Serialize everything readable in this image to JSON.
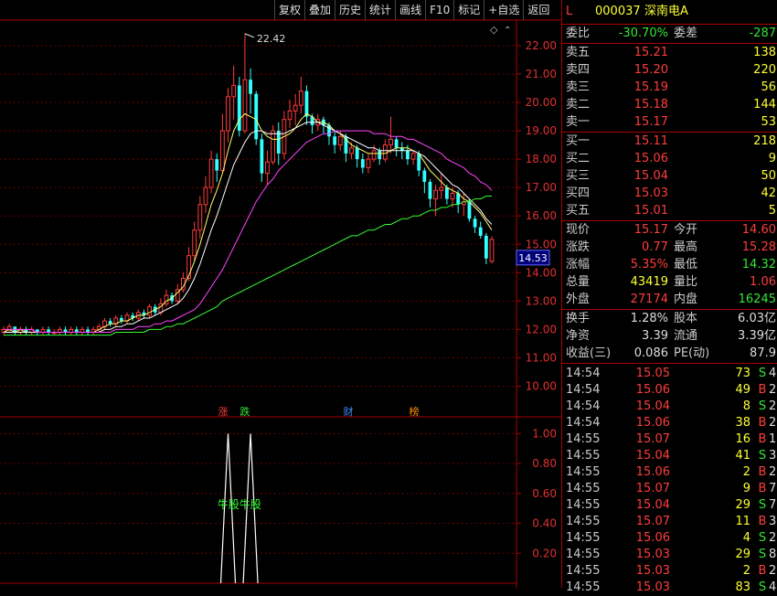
{
  "toolbar": [
    "复权",
    "叠加",
    "历史",
    "统计",
    "画线",
    "F10",
    "标记",
    "+自选",
    "返回"
  ],
  "header": {
    "flag": "L",
    "code": "000037",
    "name": "深南电A"
  },
  "ratio": {
    "wb_label": "委比",
    "wb_value": "-30.70%",
    "wc_label": "委差",
    "wc_value": "-287"
  },
  "asks": [
    {
      "label": "卖五",
      "price": "15.21",
      "vol": "138"
    },
    {
      "label": "卖四",
      "price": "15.20",
      "vol": "220"
    },
    {
      "label": "卖三",
      "price": "15.19",
      "vol": "56"
    },
    {
      "label": "卖二",
      "price": "15.18",
      "vol": "144"
    },
    {
      "label": "卖一",
      "price": "15.17",
      "vol": "53"
    }
  ],
  "bids": [
    {
      "label": "买一",
      "price": "15.11",
      "vol": "218"
    },
    {
      "label": "买二",
      "price": "15.06",
      "vol": "9"
    },
    {
      "label": "买三",
      "price": "15.04",
      "vol": "50"
    },
    {
      "label": "买四",
      "price": "15.03",
      "vol": "42"
    },
    {
      "label": "买五",
      "price": "15.01",
      "vol": "5"
    }
  ],
  "stats": [
    {
      "l1": "现价",
      "v1": "15.17",
      "c1": "red",
      "l2": "今开",
      "v2": "14.60",
      "c2": "red"
    },
    {
      "l1": "涨跌",
      "v1": "0.77",
      "c1": "red",
      "l2": "最高",
      "v2": "15.28",
      "c2": "red"
    },
    {
      "l1": "涨幅",
      "v1": "5.35%",
      "c1": "red",
      "l2": "最低",
      "v2": "14.32",
      "c2": "grn"
    },
    {
      "l1": "总量",
      "v1": "43419",
      "c1": "yel",
      "l2": "量比",
      "v2": "1.06",
      "c2": "red"
    },
    {
      "l1": "外盘",
      "v1": "27174",
      "c1": "red",
      "l2": "内盘",
      "v2": "16245",
      "c2": "grn"
    }
  ],
  "stats2": [
    {
      "l1": "换手",
      "v1": "1.28%",
      "l2": "股本",
      "v2": "6.03亿"
    },
    {
      "l1": "净资",
      "v1": "3.39",
      "l2": "流通",
      "v2": "3.39亿"
    },
    {
      "l1": "收益(三)",
      "v1": "0.086",
      "l2": "PE(动)",
      "v2": "87.9"
    }
  ],
  "ticks": [
    {
      "t": "14:54",
      "p": "15.05",
      "pc": "red",
      "v": "73",
      "f": "S",
      "fc": "grn",
      "n": "4"
    },
    {
      "t": "14:54",
      "p": "15.06",
      "pc": "red",
      "v": "49",
      "f": "B",
      "fc": "red",
      "n": "2"
    },
    {
      "t": "14:54",
      "p": "15.04",
      "pc": "red",
      "v": "8",
      "f": "S",
      "fc": "grn",
      "n": "2"
    },
    {
      "t": "14:54",
      "p": "15.06",
      "pc": "red",
      "v": "38",
      "f": "B",
      "fc": "red",
      "n": "2"
    },
    {
      "t": "14:55",
      "p": "15.07",
      "pc": "red",
      "v": "16",
      "f": "B",
      "fc": "red",
      "n": "1"
    },
    {
      "t": "14:55",
      "p": "15.04",
      "pc": "red",
      "v": "41",
      "f": "S",
      "fc": "grn",
      "n": "3"
    },
    {
      "t": "14:55",
      "p": "15.06",
      "pc": "red",
      "v": "2",
      "f": "B",
      "fc": "red",
      "n": "2"
    },
    {
      "t": "14:55",
      "p": "15.07",
      "pc": "red",
      "v": "9",
      "f": "B",
      "fc": "red",
      "n": "7"
    },
    {
      "t": "14:55",
      "p": "15.04",
      "pc": "red",
      "v": "29",
      "f": "S",
      "fc": "grn",
      "n": "7"
    },
    {
      "t": "14:55",
      "p": "15.07",
      "pc": "red",
      "v": "11",
      "f": "B",
      "fc": "red",
      "n": "3"
    },
    {
      "t": "14:55",
      "p": "15.06",
      "pc": "red",
      "v": "4",
      "f": "S",
      "fc": "grn",
      "n": "2"
    },
    {
      "t": "14:55",
      "p": "15.03",
      "pc": "red",
      "v": "29",
      "f": "S",
      "fc": "grn",
      "n": "8"
    },
    {
      "t": "14:55",
      "p": "15.03",
      "pc": "red",
      "v": "2",
      "f": "B",
      "fc": "red",
      "n": "2"
    },
    {
      "t": "14:55",
      "p": "15.03",
      "pc": "red",
      "v": "83",
      "f": "S",
      "fc": "grn",
      "n": "4"
    }
  ],
  "chart_data": {
    "type": "candlestick",
    "y_ticks": [
      "22.00",
      "21.00",
      "20.00",
      "19.00",
      "18.00",
      "17.00",
      "16.00",
      "15.00",
      "14.00",
      "13.00",
      "12.00",
      "11.00",
      "10.00"
    ],
    "ylim": [
      9.5,
      22.9
    ],
    "high_annotation": "22.42",
    "current_price_label": "14.53",
    "event_markers": [
      {
        "text": "涨",
        "color": "#ff3c3c"
      },
      {
        "text": "跌",
        "color": "#32e632"
      },
      {
        "text": "财",
        "color": "#3c8cff"
      },
      {
        "text": "榜",
        "color": "#ff8c00"
      }
    ],
    "candles": [
      [
        11.9,
        12.0,
        11.8,
        12.1
      ],
      [
        12.0,
        12.1,
        11.9,
        12.2
      ],
      [
        12.1,
        11.9,
        11.8,
        12.1
      ],
      [
        11.9,
        12.0,
        11.8,
        12.1
      ],
      [
        12.0,
        11.9,
        11.8,
        12.1
      ],
      [
        11.9,
        12.0,
        11.8,
        12.1
      ],
      [
        12.0,
        11.9,
        11.8,
        12.0
      ],
      [
        11.9,
        12.0,
        11.8,
        12.1
      ],
      [
        12.0,
        11.9,
        11.8,
        12.1
      ],
      [
        11.9,
        11.9,
        11.8,
        12.0
      ],
      [
        11.9,
        12.0,
        11.8,
        12.1
      ],
      [
        12.0,
        11.9,
        11.8,
        12.1
      ],
      [
        11.9,
        12.0,
        11.8,
        12.1
      ],
      [
        12.0,
        11.9,
        11.8,
        12.1
      ],
      [
        11.9,
        12.0,
        11.8,
        12.1
      ],
      [
        12.0,
        11.9,
        11.8,
        12.1
      ],
      [
        11.9,
        12.0,
        11.8,
        12.1
      ],
      [
        12.0,
        12.1,
        11.9,
        12.2
      ],
      [
        12.1,
        12.3,
        12.0,
        12.4
      ],
      [
        12.3,
        12.2,
        12.1,
        12.4
      ],
      [
        12.2,
        12.4,
        12.1,
        12.5
      ],
      [
        12.4,
        12.3,
        12.2,
        12.5
      ],
      [
        12.3,
        12.5,
        12.2,
        12.6
      ],
      [
        12.5,
        12.4,
        12.3,
        12.6
      ],
      [
        12.4,
        12.6,
        12.3,
        12.7
      ],
      [
        12.6,
        12.5,
        12.4,
        12.7
      ],
      [
        12.5,
        12.8,
        12.4,
        12.9
      ],
      [
        12.8,
        12.6,
        12.5,
        12.9
      ],
      [
        12.6,
        12.9,
        12.5,
        13.1
      ],
      [
        12.9,
        13.2,
        12.8,
        13.4
      ],
      [
        13.2,
        13.0,
        12.9,
        13.3
      ],
      [
        13.0,
        13.4,
        12.9,
        13.6
      ],
      [
        13.4,
        13.8,
        13.3,
        14.0
      ],
      [
        13.8,
        14.6,
        13.7,
        14.9
      ],
      [
        14.6,
        15.5,
        14.4,
        15.8
      ],
      [
        15.5,
        16.4,
        15.2,
        16.7
      ],
      [
        16.4,
        17.0,
        16.1,
        17.4
      ],
      [
        17.0,
        18.0,
        16.8,
        18.3
      ],
      [
        18.0,
        17.6,
        17.2,
        18.2
      ],
      [
        17.6,
        19.0,
        17.5,
        19.6
      ],
      [
        19.0,
        20.2,
        18.6,
        20.5
      ],
      [
        20.2,
        20.6,
        19.4,
        21.3
      ],
      [
        20.6,
        19.0,
        18.8,
        20.9
      ],
      [
        19.0,
        20.8,
        18.9,
        22.42
      ],
      [
        20.8,
        20.3,
        19.6,
        21.2
      ],
      [
        20.3,
        18.7,
        18.5,
        20.4
      ],
      [
        18.7,
        17.5,
        17.2,
        18.9
      ],
      [
        17.5,
        17.9,
        17.1,
        18.3
      ],
      [
        17.9,
        19.0,
        17.8,
        19.2
      ],
      [
        19.0,
        18.2,
        17.8,
        19.3
      ],
      [
        18.2,
        19.4,
        18.0,
        19.7
      ],
      [
        19.4,
        19.7,
        19.1,
        20.1
      ],
      [
        19.7,
        19.9,
        19.2,
        20.3
      ],
      [
        19.9,
        20.4,
        19.6,
        20.9
      ],
      [
        20.4,
        19.5,
        19.2,
        20.6
      ],
      [
        19.5,
        19.2,
        18.9,
        19.6
      ],
      [
        19.2,
        19.4,
        19.0,
        19.6
      ],
      [
        19.4,
        19.2,
        18.9,
        19.5
      ],
      [
        19.2,
        18.8,
        18.5,
        19.3
      ],
      [
        18.8,
        18.5,
        18.2,
        19.0
      ],
      [
        18.5,
        18.8,
        18.3,
        19.0
      ],
      [
        18.8,
        18.2,
        17.9,
        18.9
      ],
      [
        18.2,
        18.4,
        18.0,
        18.6
      ],
      [
        18.4,
        18.0,
        17.7,
        18.5
      ],
      [
        18.0,
        17.7,
        17.5,
        18.2
      ],
      [
        17.7,
        18.0,
        17.5,
        18.2
      ],
      [
        18.0,
        18.3,
        17.9,
        18.5
      ],
      [
        18.3,
        18.0,
        17.8,
        18.4
      ],
      [
        18.0,
        18.5,
        17.9,
        18.7
      ],
      [
        18.5,
        18.7,
        18.2,
        19.5
      ],
      [
        18.7,
        18.4,
        18.1,
        18.8
      ],
      [
        18.4,
        18.3,
        18.0,
        18.6
      ],
      [
        18.3,
        18.0,
        17.8,
        18.5
      ],
      [
        18.0,
        18.2,
        17.8,
        18.3
      ],
      [
        18.2,
        17.6,
        17.4,
        18.3
      ],
      [
        17.6,
        17.2,
        16.8,
        17.7
      ],
      [
        17.2,
        16.6,
        16.3,
        17.3
      ],
      [
        16.6,
        16.9,
        16.0,
        17.1
      ],
      [
        16.9,
        17.0,
        16.6,
        17.5
      ],
      [
        17.0,
        16.6,
        16.4,
        17.1
      ],
      [
        16.6,
        16.8,
        16.3,
        17.0
      ],
      [
        16.8,
        16.4,
        16.1,
        16.9
      ],
      [
        16.4,
        16.5,
        16.0,
        16.8
      ],
      [
        16.5,
        15.9,
        15.8,
        16.6
      ],
      [
        15.9,
        15.6,
        15.4,
        16.0
      ],
      [
        15.6,
        15.3,
        15.2,
        15.8
      ],
      [
        15.3,
        14.5,
        14.3,
        15.4
      ],
      [
        14.4,
        15.17,
        14.32,
        15.28
      ]
    ],
    "lines": [
      {
        "color": "#ffff66",
        "values": [
          11.9,
          12.0,
          11.9,
          12.0,
          11.9,
          11.9,
          11.9,
          11.9,
          11.9,
          11.9,
          11.9,
          11.9,
          11.9,
          11.9,
          11.9,
          11.9,
          11.9,
          12.0,
          12.1,
          12.2,
          12.2,
          12.3,
          12.3,
          12.4,
          12.5,
          12.5,
          12.6,
          12.7,
          12.8,
          13.0,
          13.1,
          13.3,
          13.5,
          13.9,
          14.4,
          15.0,
          15.7,
          16.4,
          16.9,
          17.5,
          18.3,
          19.0,
          19.4,
          19.6,
          19.5,
          19.4,
          19.0,
          18.8,
          18.7,
          18.7,
          18.8,
          18.9,
          19.1,
          19.4,
          19.6,
          19.5,
          19.3,
          19.3,
          19.2,
          19.0,
          18.9,
          18.7,
          18.5,
          18.4,
          18.3,
          18.2,
          18.2,
          18.2,
          18.2,
          18.3,
          18.4,
          18.4,
          18.4,
          18.3,
          18.2,
          17.9,
          17.6,
          17.4,
          17.2,
          17.0,
          16.9,
          16.8,
          16.6,
          16.5,
          16.3,
          16.1,
          15.8,
          15.5
        ]
      },
      {
        "color": "#ffffff",
        "values": [
          11.9,
          11.9,
          11.9,
          11.9,
          11.9,
          11.9,
          11.9,
          11.9,
          11.9,
          11.9,
          11.9,
          11.9,
          11.9,
          11.9,
          11.9,
          11.9,
          11.9,
          11.9,
          12.0,
          12.0,
          12.1,
          12.1,
          12.2,
          12.2,
          12.3,
          12.4,
          12.4,
          12.5,
          12.6,
          12.7,
          12.8,
          12.9,
          13.1,
          13.4,
          13.8,
          14.3,
          14.9,
          15.5,
          16.0,
          16.6,
          17.2,
          17.8,
          18.2,
          18.6,
          18.9,
          19.0,
          19.0,
          18.9,
          18.9,
          18.9,
          18.9,
          19.0,
          19.1,
          19.2,
          19.3,
          19.3,
          19.3,
          19.2,
          19.1,
          19.0,
          18.9,
          18.8,
          18.7,
          18.6,
          18.5,
          18.4,
          18.4,
          18.3,
          18.3,
          18.3,
          18.3,
          18.3,
          18.3,
          18.3,
          18.2,
          18.1,
          17.9,
          17.7,
          17.5,
          17.3,
          17.1,
          17.0,
          16.8,
          16.6,
          16.4,
          16.2,
          15.9,
          15.7
        ]
      },
      {
        "color": "#ff44ff",
        "values": [
          12.0,
          12.0,
          12.0,
          12.0,
          12.0,
          12.0,
          11.9,
          11.9,
          11.9,
          11.9,
          11.9,
          11.9,
          11.9,
          11.9,
          11.9,
          11.9,
          11.9,
          11.9,
          11.9,
          11.9,
          12.0,
          12.0,
          12.0,
          12.0,
          12.1,
          12.1,
          12.1,
          12.2,
          12.2,
          12.3,
          12.3,
          12.4,
          12.5,
          12.6,
          12.7,
          12.9,
          13.2,
          13.5,
          13.8,
          14.1,
          14.5,
          14.9,
          15.3,
          15.7,
          16.1,
          16.5,
          16.8,
          17.1,
          17.3,
          17.6,
          17.8,
          18.0,
          18.2,
          18.4,
          18.6,
          18.7,
          18.8,
          18.9,
          18.9,
          19.0,
          19.0,
          19.0,
          19.0,
          19.0,
          19.0,
          19.0,
          18.9,
          18.9,
          18.9,
          18.8,
          18.8,
          18.8,
          18.7,
          18.7,
          18.6,
          18.5,
          18.4,
          18.3,
          18.2,
          18.0,
          17.9,
          17.8,
          17.7,
          17.5,
          17.4,
          17.2,
          17.1,
          16.9
        ]
      },
      {
        "color": "#33ff33",
        "values": [
          11.8,
          11.8,
          11.8,
          11.8,
          11.8,
          11.8,
          11.8,
          11.8,
          11.8,
          11.8,
          11.8,
          11.8,
          11.8,
          11.8,
          11.8,
          11.8,
          11.8,
          11.8,
          11.8,
          11.8,
          11.9,
          11.9,
          11.9,
          11.9,
          11.9,
          11.9,
          12.0,
          12.0,
          12.0,
          12.1,
          12.1,
          12.2,
          12.2,
          12.3,
          12.4,
          12.5,
          12.6,
          12.7,
          12.8,
          13.0,
          13.1,
          13.2,
          13.3,
          13.4,
          13.5,
          13.6,
          13.7,
          13.8,
          13.9,
          14.0,
          14.1,
          14.2,
          14.3,
          14.4,
          14.5,
          14.6,
          14.7,
          14.8,
          14.9,
          15.0,
          15.1,
          15.2,
          15.3,
          15.3,
          15.4,
          15.5,
          15.5,
          15.6,
          15.7,
          15.7,
          15.8,
          15.9,
          15.9,
          16.0,
          16.0,
          16.1,
          16.2,
          16.2,
          16.3,
          16.3,
          16.4,
          16.4,
          16.5,
          16.5,
          16.6,
          16.6,
          16.7,
          16.7
        ]
      }
    ],
    "indicator": {
      "label": "牛股牛股",
      "y_ticks": [
        "1.00",
        "0.80",
        "0.60",
        "0.40",
        "0.20"
      ],
      "ylim": [
        0,
        1.1
      ],
      "peaks_at_index": [
        40,
        44
      ]
    }
  }
}
